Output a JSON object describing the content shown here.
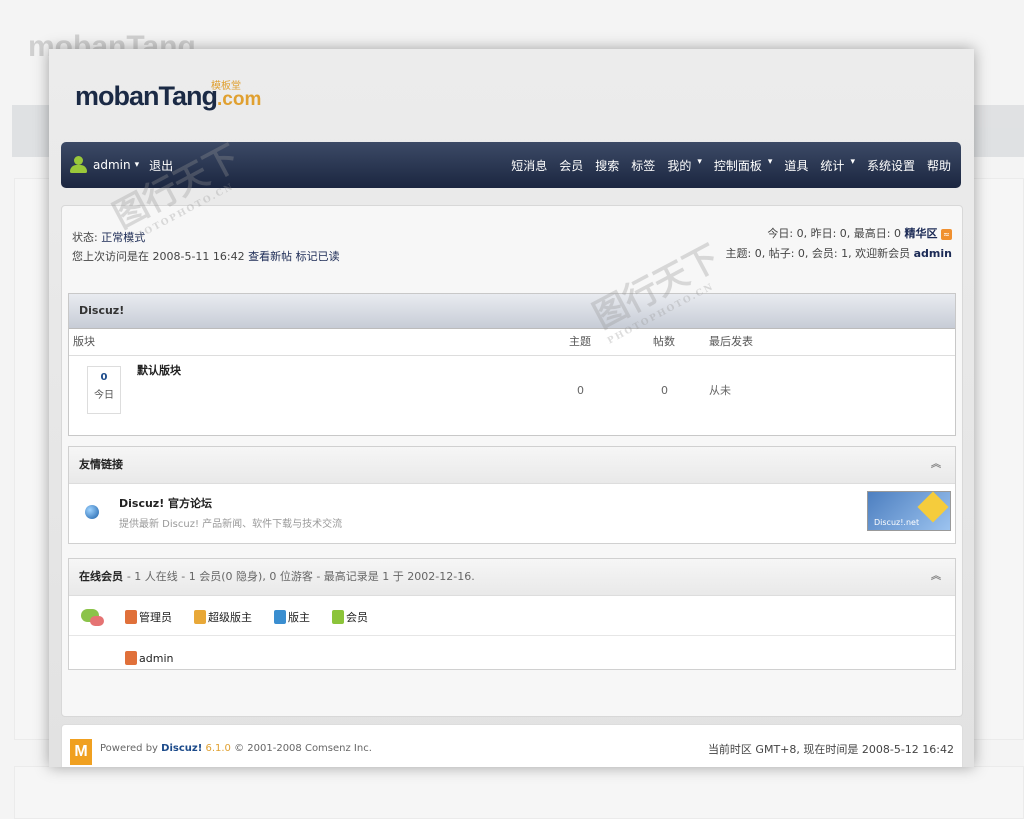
{
  "brand": {
    "logo_main": "mobanTang",
    "logo_suffix": ".com",
    "logo_cn": "模板堂"
  },
  "nav": {
    "user": "admin",
    "logout": "退出",
    "menu": [
      "短消息",
      "会员",
      "搜索",
      "标签",
      "我的",
      "控制面板",
      "道具",
      "统计",
      "系统设置",
      "帮助"
    ]
  },
  "status": {
    "label": "状态:",
    "mode": "正常模式",
    "last_visit": "您上次访问是在 2008-5-11 16:42",
    "view_new": "查看新帖",
    "mark_read": "标记已读"
  },
  "stats": {
    "line1": "今日: 0, 昨日: 0, 最高日: 0",
    "digest": "精华区",
    "line2": "主题: 0, 帖子: 0, 会员: 1, 欢迎新会员",
    "new_member": "admin"
  },
  "forum": {
    "category": "Discuz!",
    "headers": {
      "board": "版块",
      "threads": "主题",
      "posts": "帖数",
      "last_post": "最后发表"
    },
    "row": {
      "today_count": "0",
      "today_label": "今日",
      "name": "默认版块",
      "threads": "0",
      "posts": "0",
      "last_post": "从未"
    }
  },
  "links": {
    "title": "友情链接",
    "name": "Discuz! 官方论坛",
    "desc": "提供最新 Discuz! 产品新闻、软件下载与技术交流",
    "badge": "Discuz!.net"
  },
  "online": {
    "title": "在线会员",
    "summary": "- 1 人在线 - 1 会员(0 隐身), 0 位游客 - 最高记录是 1 于 2002-12-16.",
    "groups": [
      {
        "label": "管理员",
        "color": "#e0703a"
      },
      {
        "label": "超级版主",
        "color": "#e8a838"
      },
      {
        "label": "版主",
        "color": "#3a8ed0"
      },
      {
        "label": "会员",
        "color": "#8cc43a"
      }
    ],
    "user": "admin"
  },
  "footer": {
    "logo": "M",
    "powered": "Powered by",
    "product": "Discuz!",
    "version": "6.1.0",
    "copyright": "© 2001-2008 Comsenz Inc.",
    "tz": "当前时区 GMT+8, 现在时间是 2008-5-12 16:42"
  },
  "watermark": {
    "text": "图行天下",
    "sub": "PHOTOPHOTO.CN"
  }
}
